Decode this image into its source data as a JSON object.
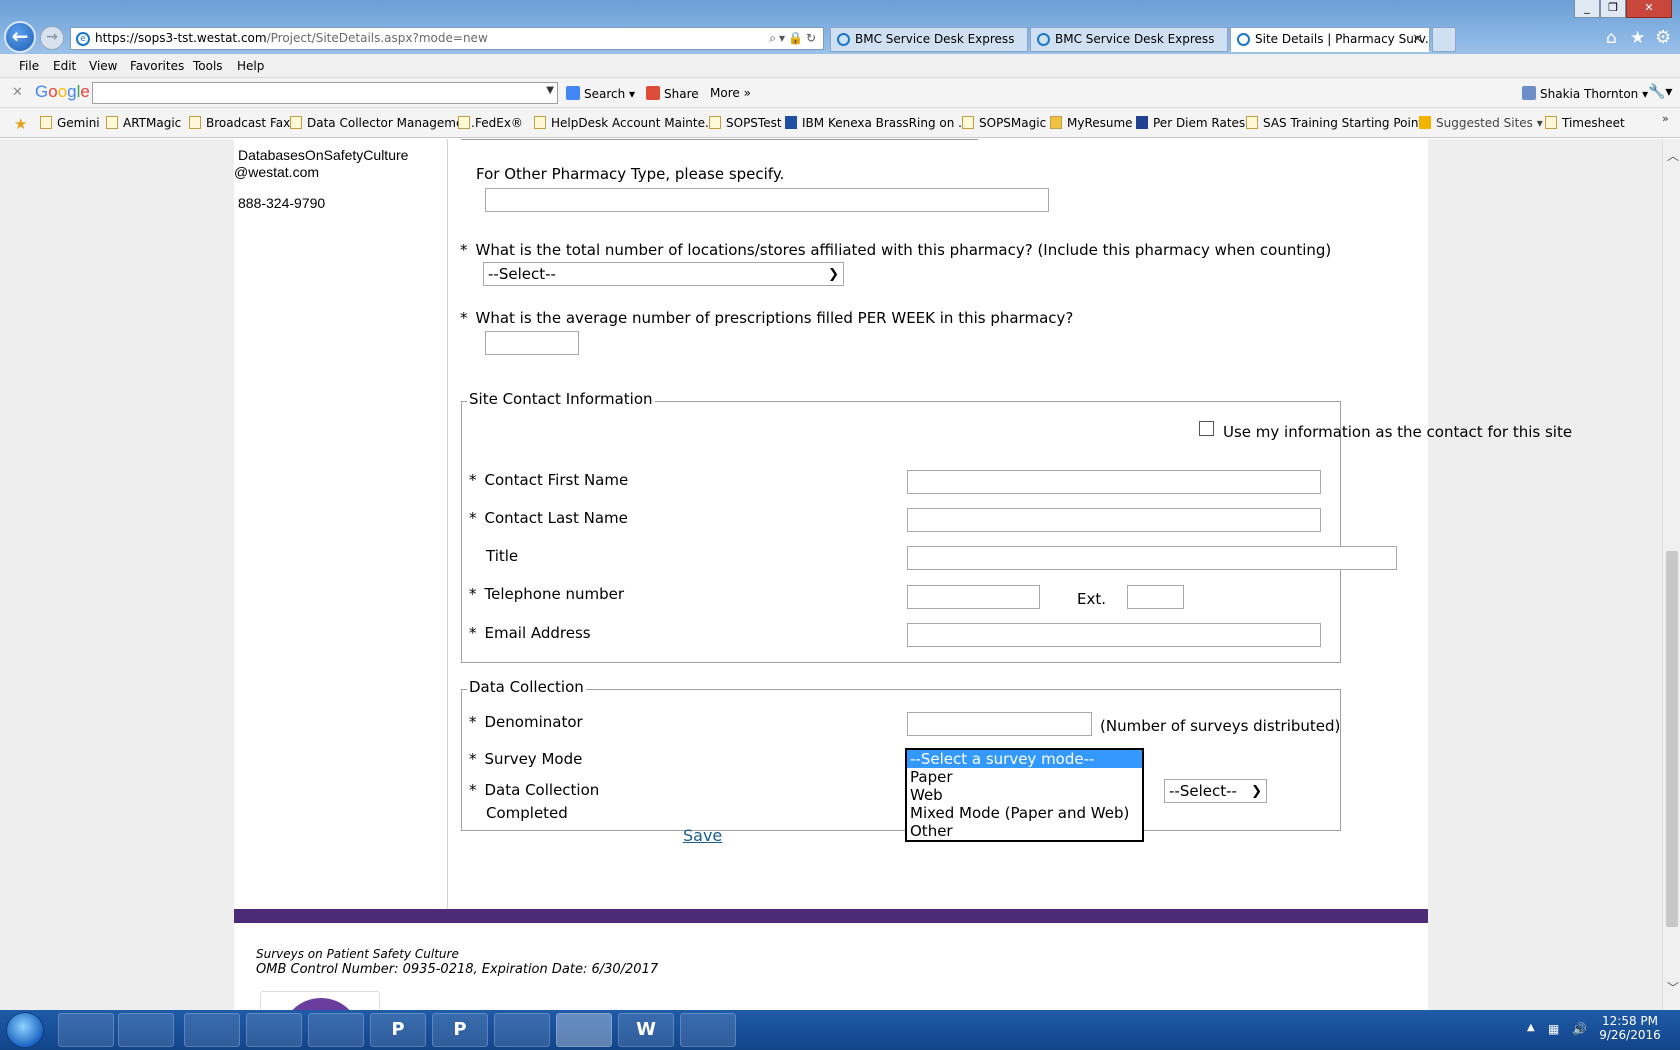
{
  "browser": {
    "url_prefix": "https://sops3-tst.",
    "url_host": "westat.com",
    "url_rest": "/Project/SiteDetails.aspx?mode=new",
    "tabs": [
      {
        "label": "BMC Service Desk Express"
      },
      {
        "label": "BMC Service Desk Express"
      },
      {
        "label": "Site Details | Pharmacy Surv..."
      }
    ],
    "menu": [
      "File",
      "Edit",
      "View",
      "Favorites",
      "Tools",
      "Help"
    ],
    "google_toolbar": {
      "logo": [
        "G",
        "o",
        "o",
        "g",
        "l",
        "e"
      ],
      "search": "Search",
      "share": "Share",
      "more": "More »",
      "user": "Shakia Thornton"
    },
    "bookmarks": [
      "Gemini",
      "ARTMagic",
      "Broadcast Fax",
      "Data Collector Manageme...",
      "FedEx®",
      "HelpDesk Account Mainte...",
      "SOPSTest",
      "IBM Kenexa BrassRing on ...",
      "SOPSMagic",
      "MyResume",
      "Per Diem Rates",
      "SAS Training Starting Points",
      "Suggested Sites",
      "Timesheet"
    ]
  },
  "sidebar": {
    "email_line1": "DatabasesOnSafetyCulture",
    "email_line2": "@westat.com",
    "phone": "888-324-9790"
  },
  "form": {
    "other_pharmacy_label": "For Other Pharmacy Type, please specify.",
    "locations_label": "What is the total number of locations/stores affiliated with this pharmacy? (Include this pharmacy when counting)",
    "locations_select_value": "--Select--",
    "prescriptions_label": "What is the average number of prescriptions filled PER WEEK in this pharmacy?",
    "required_marker": "*",
    "site_contact": {
      "legend": "Site Contact Information",
      "use_my_info": "Use my information as the contact for this site",
      "first_name": "Contact First Name",
      "last_name": "Contact Last Name",
      "title": "Title",
      "telephone": "Telephone number",
      "ext": "Ext.",
      "email": "Email Address"
    },
    "data_collection": {
      "legend": "Data Collection",
      "denominator": "Denominator",
      "denominator_hint": "(Number of surveys distributed)",
      "survey_mode": "Survey Mode",
      "completed_line1": "Data Collection",
      "completed_line2": "Completed",
      "completed_select_value": "--Select--",
      "survey_mode_options": [
        "--Select a survey mode--",
        "Paper",
        "Web",
        "Mixed Mode (Paper and Web)",
        "Other"
      ]
    },
    "save_label": "Save"
  },
  "footer": {
    "line1": "Surveys on Patient Safety Culture",
    "line2": "OMB Control Number: 0935-0218, Expiration Date: 6/30/2017"
  },
  "taskbar": {
    "apps": [
      "",
      "",
      "",
      "",
      "",
      "P",
      "",
      "",
      "",
      "W",
      ""
    ],
    "time": "12:58 PM",
    "date": "9/26/2016"
  }
}
